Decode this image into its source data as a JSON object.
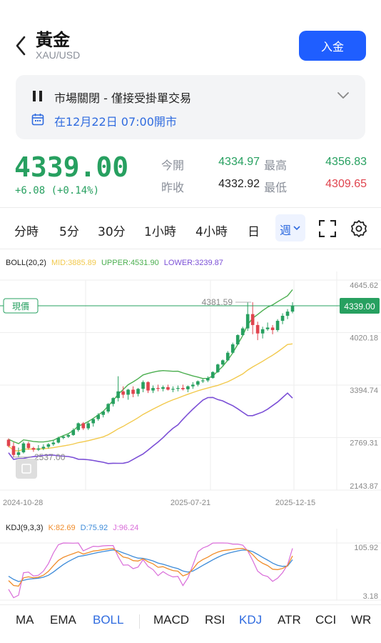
{
  "header": {
    "title": "黃金",
    "symbol": "XAU/USD",
    "deposit_label": "入金"
  },
  "status": {
    "market_text": "市場關閉 - 僅接受掛單交易",
    "open_text": "在12月22日 07:00開市"
  },
  "quote": {
    "price": "4339.00",
    "change": "+6.08 (+0.14%)",
    "open_label": "今開",
    "open_value": "4334.97",
    "high_label": "最高",
    "high_value": "4356.83",
    "prev_close_label": "昨收",
    "prev_close_value": "4332.92",
    "low_label": "最低",
    "low_value": "4309.65"
  },
  "period_tabs": [
    "分時",
    "5分",
    "30分",
    "1小時",
    "4小時",
    "日"
  ],
  "active_period": "週",
  "boll_legend": {
    "name": "BOLL(20,2)",
    "mid": "MID:3885.89",
    "upper": "UPPER:4531.90",
    "lower": "LOWER:3239.87"
  },
  "kdj_legend": {
    "name": "KDJ(9,3,3)",
    "k": "K:82.69",
    "d": "D:75.92",
    "j": "J:96.24"
  },
  "chart_data": {
    "type": "candlestick",
    "current_price_label": "現價",
    "current_price_tag": "4339.00",
    "current_price": 4339.0,
    "high_marker_label": "4381.59",
    "high_marker": 4381.59,
    "low_marker_label": "2537.00",
    "low_marker": 2537.0,
    "y_ticks": [
      "4645.62",
      "4020.18",
      "3394.74",
      "2769.31",
      "2143.87"
    ],
    "x_ticks": [
      "2024-10-28",
      "2025-07-21",
      "2025-12-15"
    ],
    "ylim": [
      2143.87,
      4645.62
    ],
    "candles": [
      [
        2744,
        2760,
        2653,
        2669
      ],
      [
        2669,
        2715,
        2536,
        2563
      ],
      [
        2563,
        2650,
        2537,
        2594
      ],
      [
        2594,
        2720,
        2580,
        2700
      ],
      [
        2700,
        2720,
        2625,
        2645
      ],
      [
        2645,
        2660,
        2600,
        2625
      ],
      [
        2625,
        2680,
        2610,
        2640
      ],
      [
        2640,
        2690,
        2620,
        2660
      ],
      [
        2660,
        2705,
        2640,
        2690
      ],
      [
        2690,
        2740,
        2670,
        2710
      ],
      [
        2710,
        2780,
        2700,
        2765
      ],
      [
        2765,
        2800,
        2750,
        2780
      ],
      [
        2780,
        2820,
        2765,
        2800
      ],
      [
        2800,
        2880,
        2790,
        2860
      ],
      [
        2860,
        2950,
        2840,
        2940
      ],
      [
        2940,
        2955,
        2860,
        2880
      ],
      [
        2880,
        2960,
        2860,
        2940
      ],
      [
        2940,
        3000,
        2900,
        2990
      ],
      [
        2990,
        3060,
        2970,
        3040
      ],
      [
        3040,
        3090,
        3010,
        3080
      ],
      [
        3080,
        3180,
        3060,
        3170
      ],
      [
        3170,
        3250,
        3140,
        3240
      ],
      [
        3240,
        3500,
        3200,
        3320
      ],
      [
        3320,
        3380,
        3240,
        3280
      ],
      [
        3280,
        3350,
        3220,
        3340
      ],
      [
        3340,
        3380,
        3250,
        3290
      ],
      [
        3290,
        3360,
        3260,
        3350
      ],
      [
        3350,
        3450,
        3310,
        3430
      ],
      [
        3430,
        3440,
        3300,
        3330
      ],
      [
        3330,
        3390,
        3300,
        3360
      ],
      [
        3360,
        3400,
        3320,
        3350
      ],
      [
        3350,
        3390,
        3320,
        3370
      ],
      [
        3370,
        3400,
        3330,
        3340
      ],
      [
        3340,
        3380,
        3310,
        3350
      ],
      [
        3350,
        3390,
        3320,
        3360
      ],
      [
        3360,
        3400,
        3330,
        3345
      ],
      [
        3345,
        3390,
        3310,
        3380
      ],
      [
        3380,
        3430,
        3350,
        3400
      ],
      [
        3400,
        3450,
        3380,
        3440
      ],
      [
        3440,
        3470,
        3420,
        3450
      ],
      [
        3450,
        3500,
        3430,
        3480
      ],
      [
        3480,
        3560,
        3470,
        3550
      ],
      [
        3550,
        3650,
        3540,
        3640
      ],
      [
        3640,
        3700,
        3620,
        3690
      ],
      [
        3690,
        3800,
        3680,
        3780
      ],
      [
        3780,
        3900,
        3770,
        3880
      ],
      [
        3880,
        4000,
        3870,
        3990
      ],
      [
        3990,
        4090,
        3980,
        4070
      ],
      [
        4070,
        4380,
        4040,
        4240
      ],
      [
        4240,
        4382,
        4000,
        4110
      ],
      [
        4110,
        4150,
        3930,
        4010
      ],
      [
        4010,
        4090,
        3950,
        4060
      ],
      [
        4060,
        4140,
        4040,
        4080
      ],
      [
        4080,
        4110,
        4000,
        4050
      ],
      [
        4050,
        4180,
        4030,
        4160
      ],
      [
        4160,
        4250,
        4120,
        4220
      ],
      [
        4220,
        4300,
        4180,
        4270
      ],
      [
        4270,
        4382,
        4250,
        4339
      ]
    ],
    "boll_upper_end": 4531.9,
    "boll_mid_end": 3885.89,
    "boll_lower_end": 3239.87,
    "kdj_ticks": [
      "105.92",
      "3.18"
    ]
  },
  "indicator_tabs": [
    "MA",
    "EMA",
    "BOLL",
    "MACD",
    "RSI",
    "KDJ",
    "ATR",
    "CCI",
    "WR"
  ],
  "active_indicators": [
    "BOLL",
    "KDJ"
  ],
  "colors": {
    "accent": "#1f5eff",
    "up": "#27a060",
    "down": "#e0444e",
    "mid": "#f2c94c",
    "upper": "#4caf50",
    "lower": "#7b4fd6",
    "k": "#f08c2a",
    "d": "#3d8bd9",
    "j": "#d96cd9"
  }
}
